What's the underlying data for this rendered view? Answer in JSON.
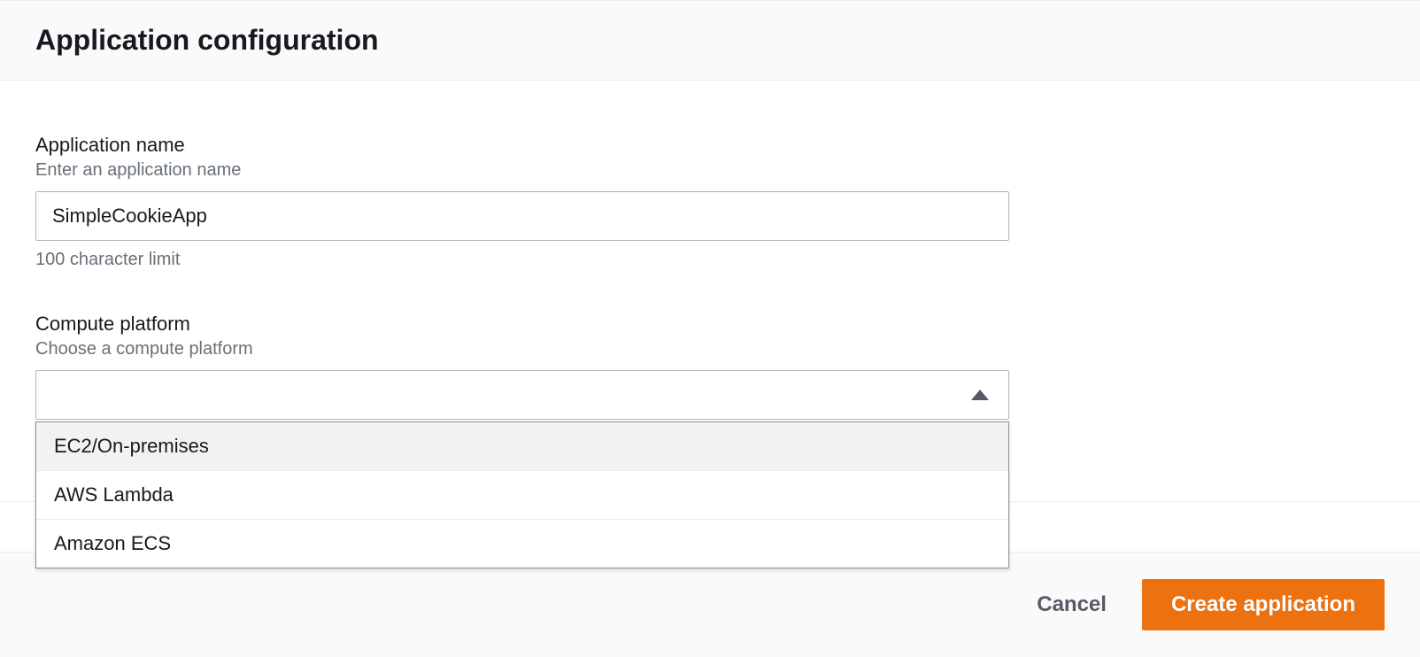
{
  "header": {
    "title": "Application configuration"
  },
  "app_name": {
    "label": "Application name",
    "hint": "Enter an application name",
    "value": "SimpleCookieApp",
    "help": "100 character limit"
  },
  "compute_platform": {
    "label": "Compute platform",
    "hint": "Choose a compute platform",
    "selected": "",
    "options": [
      "EC2/On-premises",
      "AWS Lambda",
      "Amazon ECS"
    ]
  },
  "footer": {
    "cancel": "Cancel",
    "submit": "Create application"
  }
}
